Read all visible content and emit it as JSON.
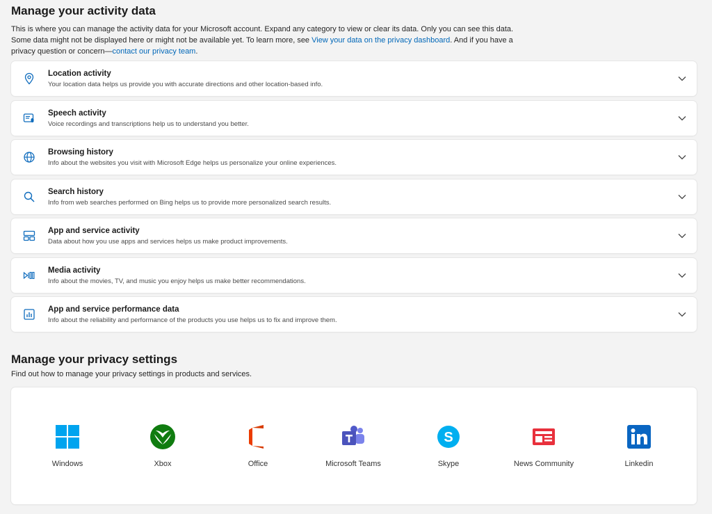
{
  "activity_section": {
    "title": "Manage your activity data",
    "intro_text_1": "This is where you can manage the activity data for your Microsoft account. Expand any category to view or clear its data. Only you can see this data. Some data might not be displayed here or might not be available yet. To learn more, see ",
    "intro_link_1": "View your data on the privacy dashboard",
    "intro_text_2": ". And if you have a privacy question or concern—",
    "intro_link_2": "contact our privacy team",
    "intro_text_3": ".",
    "items": [
      {
        "title": "Location activity",
        "description": "Your location data helps us provide you with accurate directions and other location-based info.",
        "icon": "location-pin-icon"
      },
      {
        "title": "Speech activity",
        "description": "Voice recordings and transcriptions help us to understand you better.",
        "icon": "speech-icon"
      },
      {
        "title": "Browsing history",
        "description": "Info about the websites you visit with Microsoft Edge helps us personalize your online experiences.",
        "icon": "globe-icon"
      },
      {
        "title": "Search history",
        "description": "Info from web searches performed on Bing helps us to provide more personalized search results.",
        "icon": "search-icon"
      },
      {
        "title": "App and service activity",
        "description": "Data about how you use apps and services helps us make product improvements.",
        "icon": "apps-icon"
      },
      {
        "title": "Media activity",
        "description": "Info about the movies, TV, and music you enjoy helps us make better recommendations.",
        "icon": "media-icon"
      },
      {
        "title": "App and service performance data",
        "description": "Info about the reliability and performance of the products you use helps us to fix and improve them.",
        "icon": "chart-icon"
      }
    ]
  },
  "privacy_section": {
    "title": "Manage your privacy settings",
    "subtitle": "Find out how to manage your privacy settings in products and services.",
    "apps": [
      {
        "label": "Windows",
        "icon": "windows-logo-icon"
      },
      {
        "label": "Xbox",
        "icon": "xbox-logo-icon"
      },
      {
        "label": "Office",
        "icon": "office-logo-icon"
      },
      {
        "label": "Microsoft Teams",
        "icon": "teams-logo-icon"
      },
      {
        "label": "Skype",
        "icon": "skype-logo-icon"
      },
      {
        "label": "News Community",
        "icon": "news-logo-icon"
      },
      {
        "label": "Linkedin",
        "icon": "linkedin-logo-icon"
      }
    ]
  },
  "colors": {
    "accent": "#0067b8",
    "icon_blue": "#0f6cbd",
    "background": "#f3f3f3"
  }
}
